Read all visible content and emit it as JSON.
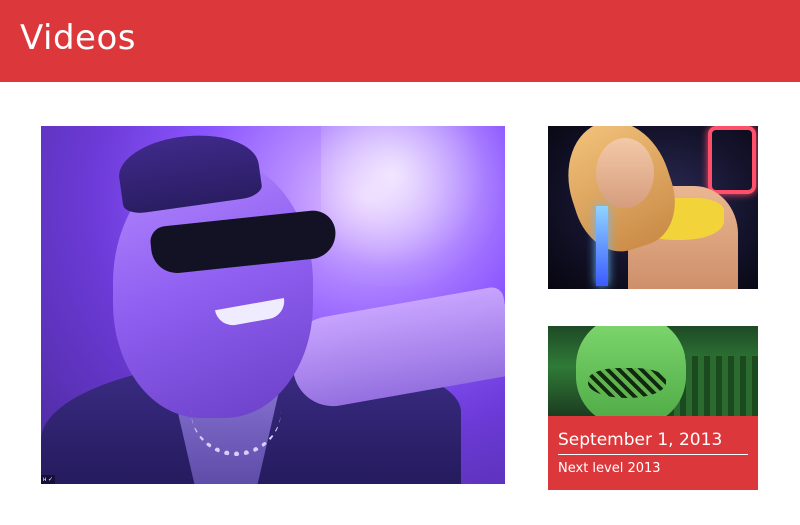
{
  "header": {
    "title": "Videos",
    "background_color": "#dc373b"
  },
  "feature_video": {
    "corner_mark": "ʜ ✓"
  },
  "thumbnails": [
    {
      "caption_date": "",
      "caption_title": ""
    },
    {
      "caption_date": "September 1, 2013",
      "caption_title": "Next level 2013"
    }
  ],
  "colors": {
    "accent": "#dc373b",
    "text_on_accent": "#ffffff"
  }
}
